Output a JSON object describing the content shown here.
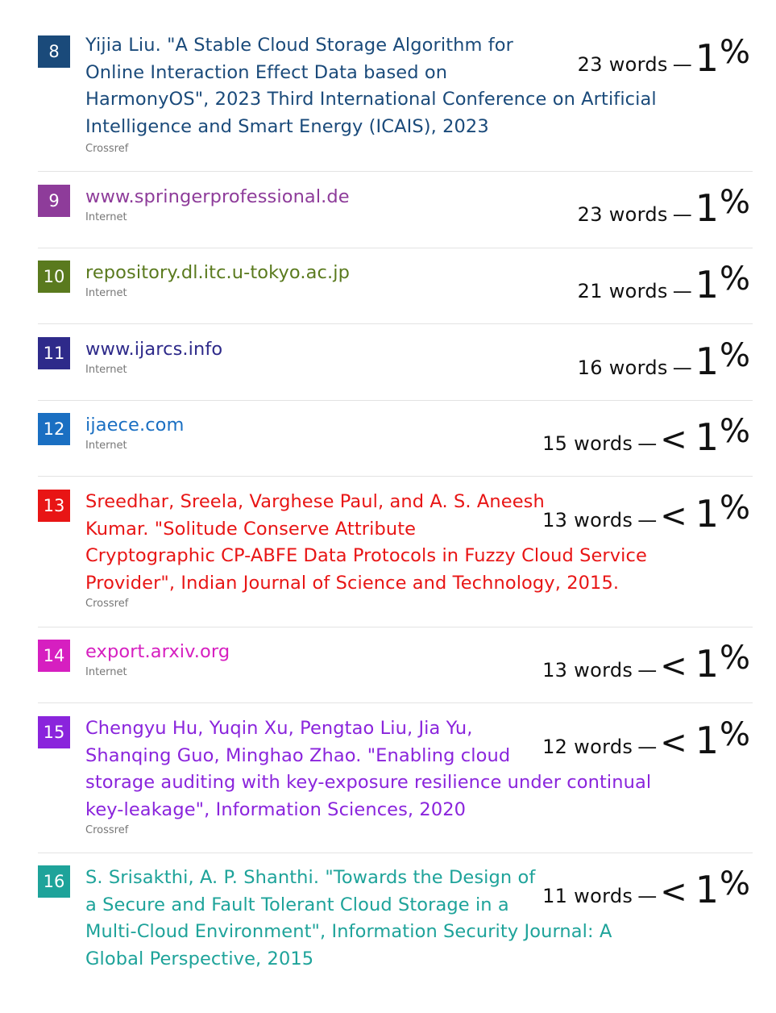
{
  "matches": [
    {
      "num": "8",
      "color": "#1a4a7a",
      "title_lines": [
        "Yijia Liu. \"A Stable Cloud Storage Algorithm for",
        "Online Interaction Effect Data based on",
        "HarmonyOS\", 2023 Third International Conference on Artificial",
        "Intelligence and Smart Energy (ICAIS), 2023"
      ],
      "source": "Crossref",
      "words": "23 words",
      "dash": "—",
      "lt": "",
      "pct_num": "1",
      "pct_sym": "%"
    },
    {
      "num": "9",
      "color": "#8e3c9a",
      "title_lines": [
        "www.springerprofessional.de"
      ],
      "source": "Internet",
      "words": "23 words",
      "dash": "—",
      "lt": "",
      "pct_num": "1",
      "pct_sym": "%"
    },
    {
      "num": "10",
      "color": "#5a7a1e",
      "title_lines": [
        "repository.dl.itc.u-tokyo.ac.jp"
      ],
      "source": "Internet",
      "words": "21 words",
      "dash": "—",
      "lt": "",
      "pct_num": "1",
      "pct_sym": "%"
    },
    {
      "num": "11",
      "color": "#2e2a8a",
      "title_lines": [
        "www.ijarcs.info"
      ],
      "source": "Internet",
      "words": "16 words",
      "dash": "—",
      "lt": "",
      "pct_num": "1",
      "pct_sym": "%"
    },
    {
      "num": "12",
      "color": "#1a6fc2",
      "title_lines": [
        "ijaece.com"
      ],
      "source": "Internet",
      "words": "15 words",
      "dash": "—",
      "lt": "<",
      "pct_num": "1",
      "pct_sym": "%"
    },
    {
      "num": "13",
      "color": "#e81515",
      "title_lines": [
        "Sreedhar, Sreela, Varghese Paul, and A. S. Aneesh",
        "Kumar. \"Solitude Conserve Attribute",
        "Cryptographic CP-ABFE Data Protocols in Fuzzy Cloud Service",
        "Provider\", Indian Journal of Science and Technology, 2015."
      ],
      "source": "Crossref",
      "words": "13 words",
      "dash": "—",
      "lt": "<",
      "pct_num": "1",
      "pct_sym": "%"
    },
    {
      "num": "14",
      "color": "#d61fc0",
      "title_lines": [
        "export.arxiv.org"
      ],
      "source": "Internet",
      "words": "13 words",
      "dash": "—",
      "lt": "<",
      "pct_num": "1",
      "pct_sym": "%"
    },
    {
      "num": "15",
      "color": "#8a24dc",
      "title_lines": [
        "Chengyu Hu, Yuqin Xu, Pengtao Liu, Jia Yu,",
        "Shanqing Guo, Minghao Zhao. \"Enabling cloud",
        "storage auditing with key-exposure resilience under continual",
        "key-leakage\", Information Sciences, 2020"
      ],
      "source": "Crossref",
      "words": "12 words",
      "dash": "—",
      "lt": "<",
      "pct_num": "1",
      "pct_sym": "%"
    },
    {
      "num": "16",
      "color": "#1ea39a",
      "title_lines": [
        "S. Srisakthi, A. P. Shanthi. \"Towards the Design of",
        "a Secure and Fault Tolerant Cloud Storage in a",
        "Multi-Cloud Environment\", Information Security Journal: A",
        "Global Perspective, 2015"
      ],
      "source": "",
      "words": "11 words",
      "dash": "—",
      "lt": "<",
      "pct_num": "1",
      "pct_sym": "%"
    }
  ]
}
